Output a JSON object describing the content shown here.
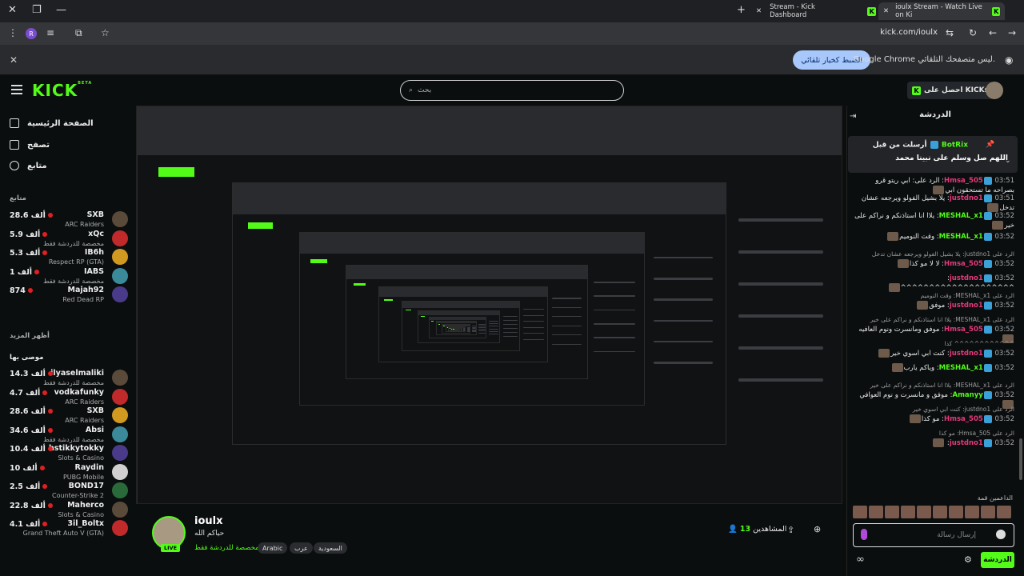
{
  "browser": {
    "tabs": [
      {
        "label": "Stream - Kick Dashboard"
      },
      {
        "label": "ioulx Stream - Watch Live on Ki"
      }
    ],
    "url": "kick.com/ioulx",
    "profile_initial": "R"
  },
  "notice": {
    "text": "Google Chrome ليس متصفحك التلقائي.",
    "button": "الضبط كخيار تلقائي"
  },
  "header": {
    "logo": "KICK",
    "logo_sup": "BETA",
    "search_placeholder": "بحث",
    "get_kicks": "احصل على KICKs"
  },
  "sidebar": {
    "nav": [
      {
        "label": "الصفحة الرئيسية",
        "icon": "home-icon"
      },
      {
        "label": "تصفح",
        "icon": "browse-icon"
      },
      {
        "label": "متابع",
        "icon": "heart-icon"
      }
    ],
    "following_title": "متابع",
    "show_more": "أظهر المزيد",
    "recommended_title": "موصى بها",
    "following": [
      {
        "name": "SXB",
        "category": "ARC Raiders",
        "viewers": "28.6 ألف"
      },
      {
        "name": "xQc",
        "category": "مخصصة للدردشة فقط",
        "viewers": "5.9 ألف"
      },
      {
        "name": "IB6h",
        "category": "Respect RP (GTA)",
        "viewers": "5.3 ألف"
      },
      {
        "name": "IABS",
        "category": "مخصصة للدردشة فقط",
        "viewers": "1 ألف"
      },
      {
        "name": "Majah92",
        "category": "Red Dead RP",
        "viewers": "874"
      }
    ],
    "recommended": [
      {
        "name": "ilyaselmaliki",
        "category": "مخصصة للدردشة فقط",
        "viewers": "14.3 ألف"
      },
      {
        "name": "vodkafunky",
        "category": "ARC Raiders",
        "viewers": "4.7 ألف"
      },
      {
        "name": "SXB",
        "category": "ARC Raiders",
        "viewers": "28.6 ألف"
      },
      {
        "name": "Absi",
        "category": "مخصصة للدردشة فقط",
        "viewers": "34.6 ألف"
      },
      {
        "name": "hstikkytokky",
        "category": "Slots & Casino",
        "viewers": "10.4 ألف"
      },
      {
        "name": "Raydin",
        "category": "PUBG Mobile",
        "viewers": "10 ألف"
      },
      {
        "name": "BOND17",
        "category": "Counter-Strike 2",
        "viewers": "2.5 ألف"
      },
      {
        "name": "Maherco",
        "category": "Slots & Casino",
        "viewers": "22.8 ألف"
      },
      {
        "name": "3il_Boltx",
        "category": "Grand Theft Auto V (GTA)",
        "viewers": "4.1 ألف"
      }
    ]
  },
  "stream": {
    "streamer": "ioulx",
    "title": "حياكم الله",
    "category": "مخصصة للدردشة فقط",
    "tags": [
      "Arabic",
      "عرب",
      "السعودية"
    ],
    "live": "LIVE",
    "viewers_label": "المشاهدين",
    "viewers_count": "13"
  },
  "chat": {
    "title": "الدردشة",
    "pinned_by": "أرسلت من قبل",
    "pinned_user": "BotRix",
    "pinned_text": "اللهم صل وسلم على نبينا محمد",
    "messages": [
      {
        "time": "03:51",
        "user": "Hmsa_505",
        "text": "الرد على: ابي ريتو قرو بصراحه ما تستحقون ابي",
        "color": "#e4397a"
      },
      {
        "time": "03:51",
        "user": "justdno1",
        "text": "يلا بشيل الفولو ويرجعه عشان تدخل",
        "color": "#e4397a"
      },
      {
        "time": "03:52",
        "user": "MESHAL_x1",
        "text": "يلاا انا استاذنكم و نراكم على خير",
        "color": "#53fc18"
      },
      {
        "time": "03:52",
        "user": "MESHAL_x1",
        "text": "وقت النوميم",
        "color": "#53fc18"
      },
      {
        "time": "03:52",
        "user": "Hmsa_505",
        "reply": "الرد على justdno1: يلا بشيل الفولو ويرجعه عشان تدخل",
        "text": "لا لا مو كذا",
        "color": "#e4397a"
      },
      {
        "time": "03:52",
        "user": "justdno1",
        "text": "^^^^^^^^^^^^^^^^^^^^",
        "color": "#e4397a"
      },
      {
        "time": "03:52",
        "user": "justdno1",
        "reply": "الرد على MESHAL_x1: وقت النوميم",
        "text": "موفق",
        "color": "#e4397a"
      },
      {
        "time": "03:52",
        "user": "Hmsa_505",
        "reply": "الرد على MESHAL_x1: يلاا انا استاذنكم و نراكم على خير",
        "text": "موفق ومانسرت ونوم العافيه",
        "color": "#e4397a"
      },
      {
        "time": "03:52",
        "user": "justdno1",
        "reply": "^^^^^^^^^^^^ كذا",
        "text": "كنت ابي اسوي خير",
        "color": "#e4397a"
      },
      {
        "time": "03:52",
        "user": "MESHAL_x1",
        "text": "وياكم يارب",
        "color": "#53fc18"
      },
      {
        "time": "03:52",
        "user": "Amanyy",
        "reply": "الرد على MESHAL_x1: يلاا انا استاذنكم و نراكم على خير",
        "text": "موفق و مانسرت و نوم العوافي",
        "color": "#53fc18"
      },
      {
        "time": "03:52",
        "user": "Hmsa_505",
        "reply": "الرد على justdno1: كنت ابي اسوي خير",
        "text": "مو كذا",
        "color": "#e4397a"
      },
      {
        "time": "03:52",
        "user": "justdno1",
        "reply": "الرد على Hmsa_505: مو كذا",
        "text": "",
        "color": "#e4397a"
      }
    ],
    "supporters_label": "الداعمين قمة",
    "input_placeholder": "إرسال رسالة",
    "send_label": "الدردشة"
  }
}
